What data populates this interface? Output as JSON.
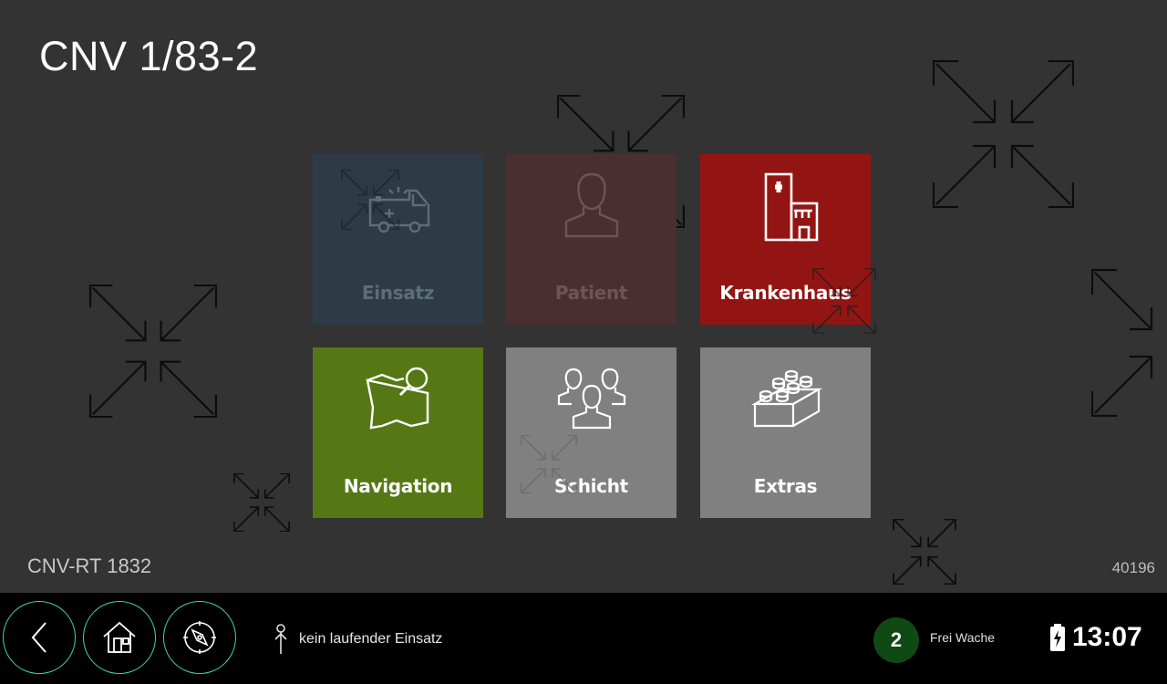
{
  "header": {
    "title": "CNV 1/83-2"
  },
  "footer_info": {
    "vehicle_id": "CNV-RT 1832",
    "device_number": "40196"
  },
  "tiles": [
    {
      "label": "Einsatz",
      "icon": "ambulance-icon",
      "color": "#2c3b45",
      "enabled": false
    },
    {
      "label": "Patient",
      "icon": "person-icon",
      "color": "#4a2f31",
      "enabled": false
    },
    {
      "label": "Krankenhaus",
      "icon": "hospital-icon",
      "color": "#921514",
      "enabled": true
    },
    {
      "label": "Navigation",
      "icon": "map-search-icon",
      "color": "#557815",
      "enabled": true
    },
    {
      "label": "Schicht",
      "icon": "team-icon",
      "color": "#808080",
      "enabled": true
    },
    {
      "label": "Extras",
      "icon": "brick-icon",
      "color": "#808080",
      "enabled": true
    }
  ],
  "bottom_bar": {
    "buttons": [
      {
        "name": "back",
        "icon": "chevron-left-icon"
      },
      {
        "name": "home",
        "icon": "home-icon"
      },
      {
        "name": "compass",
        "icon": "compass-icon"
      }
    ],
    "accent_color": "#3fd4b0",
    "mission_icon": "person-pin-icon",
    "mission_status": "kein laufender Einsatz",
    "status_code": "2",
    "status_color": "#0f4a14",
    "status_label": "Frei Wache",
    "battery_icon": "battery-charging-icon",
    "time": "13:07"
  }
}
